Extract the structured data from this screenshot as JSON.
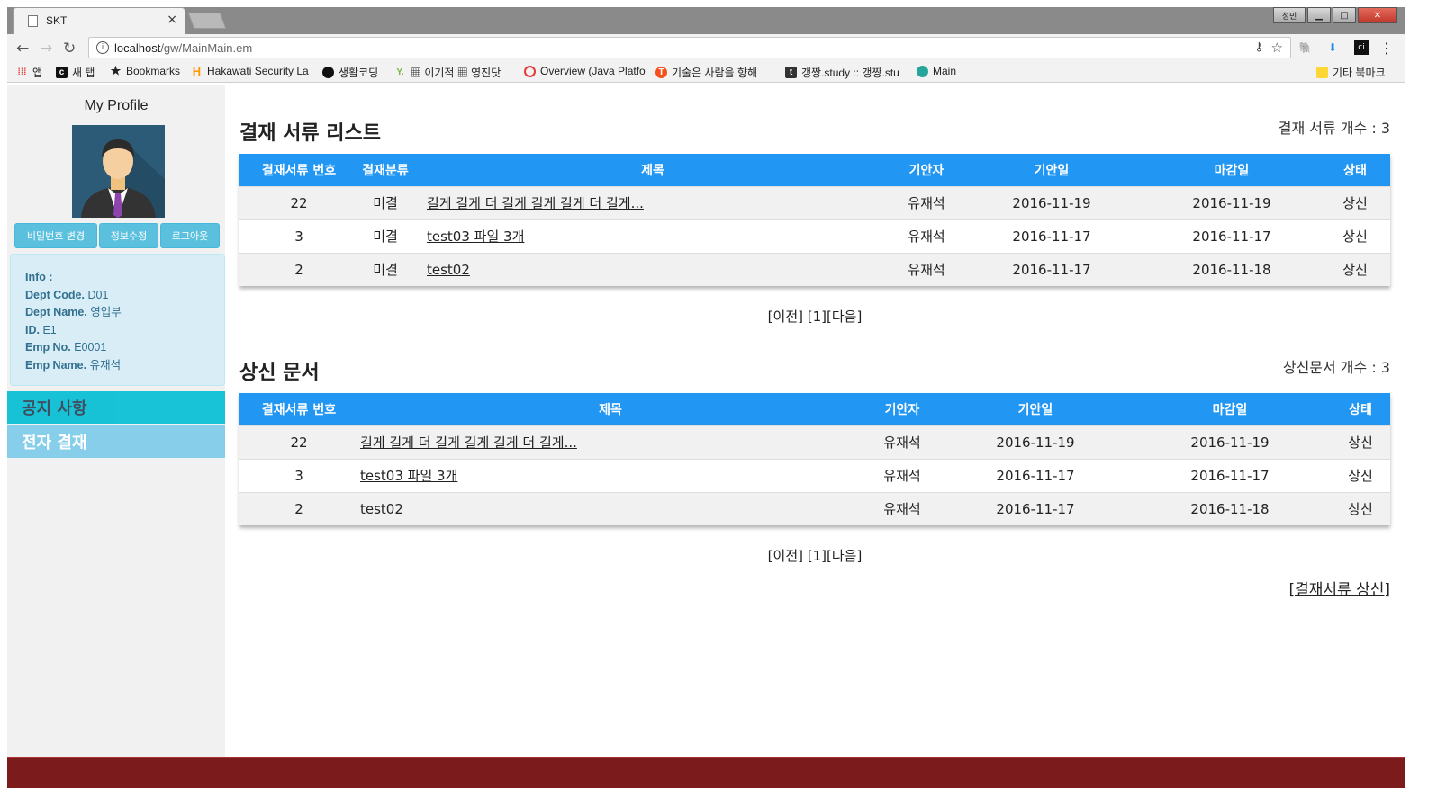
{
  "browser": {
    "tab_title": "SKT",
    "tab_close": "×",
    "url_host": "localhost",
    "url_path": "/gw/MainMain.em",
    "window_user": "정민",
    "bookmarks": [
      {
        "label": "앱",
        "icon": "apps-grid-icon"
      },
      {
        "label": "새 탭",
        "icon": "new-tab-icon"
      },
      {
        "label": "Bookmarks",
        "icon": "star-icon"
      },
      {
        "label": "Hakawati Security La",
        "icon": "h-logo-icon"
      },
      {
        "label": "생활코딩",
        "icon": "black-circle-icon"
      },
      {
        "label": "▦ 이기적 ▦ 영진닷",
        "icon": "y-logo-icon"
      },
      {
        "label": "Overview (Java Platfo",
        "icon": "oracle-icon"
      },
      {
        "label": "기술은 사람을 향해",
        "icon": "orange-circle-icon"
      },
      {
        "label": "갱짱.study :: 갱짱.stu",
        "icon": "tistory-icon"
      },
      {
        "label": "Main",
        "icon": "globe-icon"
      }
    ],
    "other_bookmarks": "기타 북마크"
  },
  "sidebar": {
    "profile_title": "My Profile",
    "buttons": {
      "change_password": "비밀번호 변경",
      "edit_info": "정보수정",
      "logout": "로그아웃"
    },
    "info": {
      "heading": "Info :",
      "dept_code_label": "Dept Code.",
      "dept_code": "D01",
      "dept_name_label": "Dept Name.",
      "dept_name": "영업부",
      "id_label": "ID.",
      "id": "E1",
      "emp_no_label": "Emp No.",
      "emp_no": "E0001",
      "emp_name_label": "Emp Name.",
      "emp_name": "유재석"
    },
    "menu": {
      "notice": "공지 사항",
      "approval": "전자 결재"
    }
  },
  "approval_list": {
    "title": "결재 서류 리스트",
    "count_text": "결재 서류 개수 : 3",
    "headers": [
      "결재서류 번호",
      "결재분류",
      "제목",
      "기안자",
      "기안일",
      "마감일",
      "상태"
    ],
    "rows": [
      {
        "no": "22",
        "category": "미결",
        "title": "길게 길게 더 길게 길게 길게 더 길게...",
        "drafter": "유재석",
        "draft_date": "2016-11-19",
        "due_date": "2016-11-19",
        "status": "상신"
      },
      {
        "no": "3",
        "category": "미결",
        "title": "test03 파일 3개",
        "drafter": "유재석",
        "draft_date": "2016-11-17",
        "due_date": "2016-11-17",
        "status": "상신"
      },
      {
        "no": "2",
        "category": "미결",
        "title": "test02",
        "drafter": "유재석",
        "draft_date": "2016-11-17",
        "due_date": "2016-11-18",
        "status": "상신"
      }
    ],
    "pager": {
      "prev": "[이전]",
      "page": "[1]",
      "next": "[다음]"
    }
  },
  "submitted_list": {
    "title": "상신 문서",
    "count_text": "상신문서 개수 : 3",
    "headers": [
      "결재서류 번호",
      "제목",
      "기안자",
      "기안일",
      "마감일",
      "상태"
    ],
    "rows": [
      {
        "no": "22",
        "title": "길게 길게 더 길게 길게 길게 더 길게...",
        "drafter": "유재석",
        "draft_date": "2016-11-19",
        "due_date": "2016-11-19",
        "status": "상신"
      },
      {
        "no": "3",
        "title": "test03 파일 3개",
        "drafter": "유재석",
        "draft_date": "2016-11-17",
        "due_date": "2016-11-17",
        "status": "상신"
      },
      {
        "no": "2",
        "title": "test02",
        "drafter": "유재석",
        "draft_date": "2016-11-17",
        "due_date": "2016-11-18",
        "status": "상신"
      }
    ],
    "pager": {
      "prev": "[이전]",
      "page": "[1]",
      "next": "[다음]"
    }
  },
  "submit_link": "[결재서류 상신]",
  "colors": {
    "table_header": "#2196f3",
    "menu_notice": "#00bcd4",
    "menu_approval": "#87ceeb",
    "info_box": "#d9edf7",
    "profile_button": "#5bc0de"
  }
}
